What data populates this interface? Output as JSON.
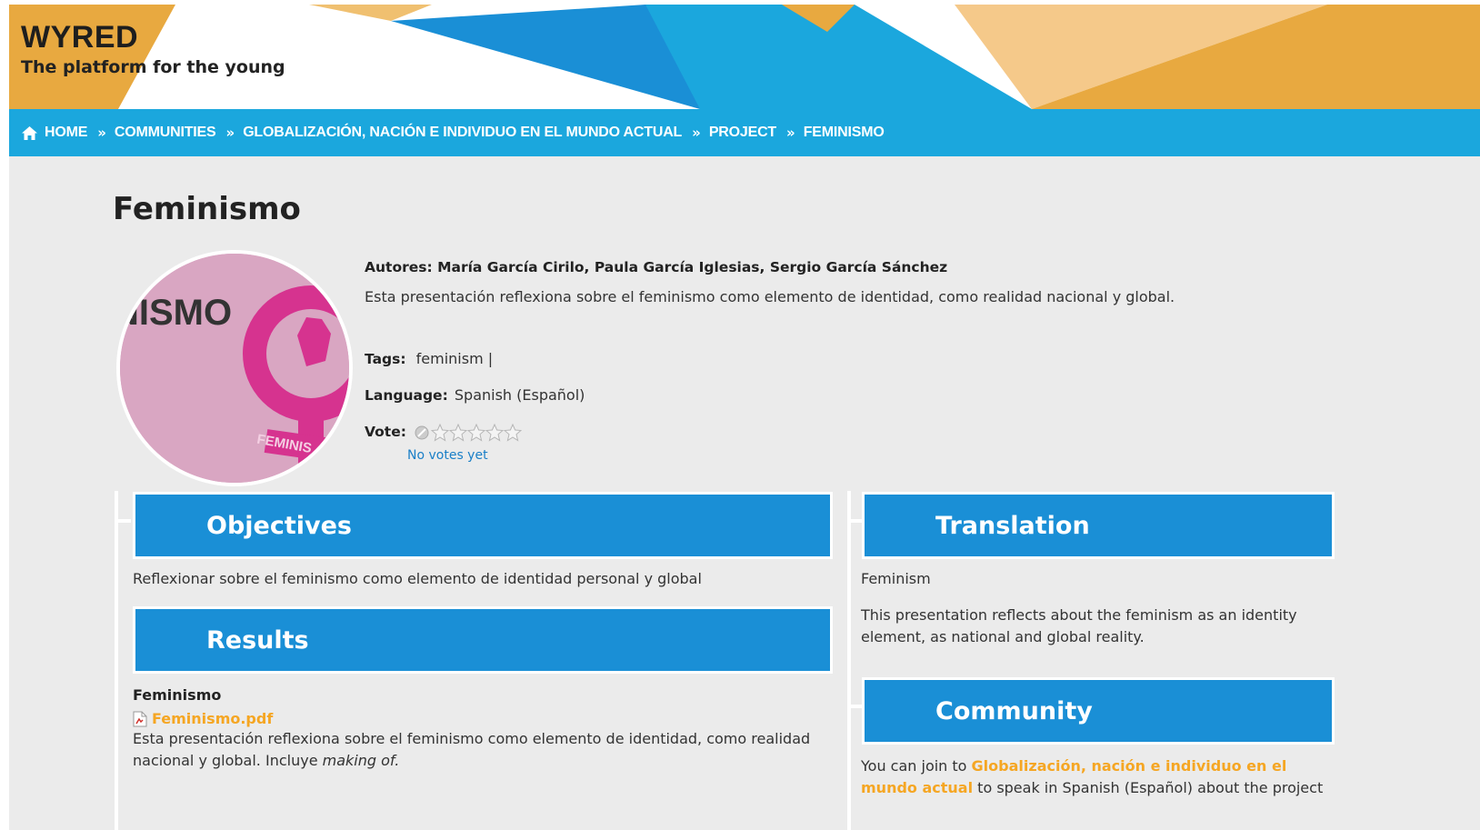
{
  "brand": {
    "name": "WYRED",
    "tagline": "The platform for the young"
  },
  "breadcrumb": {
    "items": [
      {
        "label": "HOME"
      },
      {
        "label": "COMMUNITIES"
      },
      {
        "label": "GLOBALIZACIÓN, NACIÓN E INDIVIDUO EN EL MUNDO ACTUAL"
      },
      {
        "label": "PROJECT"
      },
      {
        "label": "FEMINISMO"
      }
    ],
    "separator": "»"
  },
  "page": {
    "title": "Feminismo",
    "image_text": "NISMO",
    "image_banner_text": "FEMINIS"
  },
  "meta": {
    "authors": "Autores: María García Cirilo, Paula García Iglesias, Sergio García Sánchez",
    "description": "Esta presentación reflexiona sobre el feminismo como elemento de identidad, como realidad nacional y global.",
    "tags_label": "Tags:",
    "tags_value": "feminism |",
    "language_label": "Language:",
    "language_value": "Spanish (Español)",
    "vote_label": "Vote:",
    "vote_status": "No votes yet",
    "rating": 0,
    "rating_max": 5
  },
  "objectives": {
    "heading": "Objectives",
    "text": "Reflexionar sobre el feminismo como elemento de identidad personal y global"
  },
  "results": {
    "heading": "Results",
    "item_title": "Feminismo",
    "file_name": "Feminismo.pdf",
    "text_before": "Esta presentación reflexiona sobre el feminismo como elemento de identidad, como realidad nacional y global. Incluye ",
    "text_italic": "making of."
  },
  "translation": {
    "heading": "Translation",
    "title": "Feminism",
    "text": "This presentation reflects about the feminism as an identity element, as national and global reality."
  },
  "community": {
    "heading": "Community",
    "text_before": "You can join to ",
    "link": "Globalización, nación e individuo en el mundo actual",
    "text_after": " to speak in Spanish (Español) about the project"
  },
  "colors": {
    "accent_blue": "#1ba7dd",
    "panel_blue": "#1a8fd6",
    "orange": "#f5a623",
    "link_blue": "#1a7fc7"
  }
}
